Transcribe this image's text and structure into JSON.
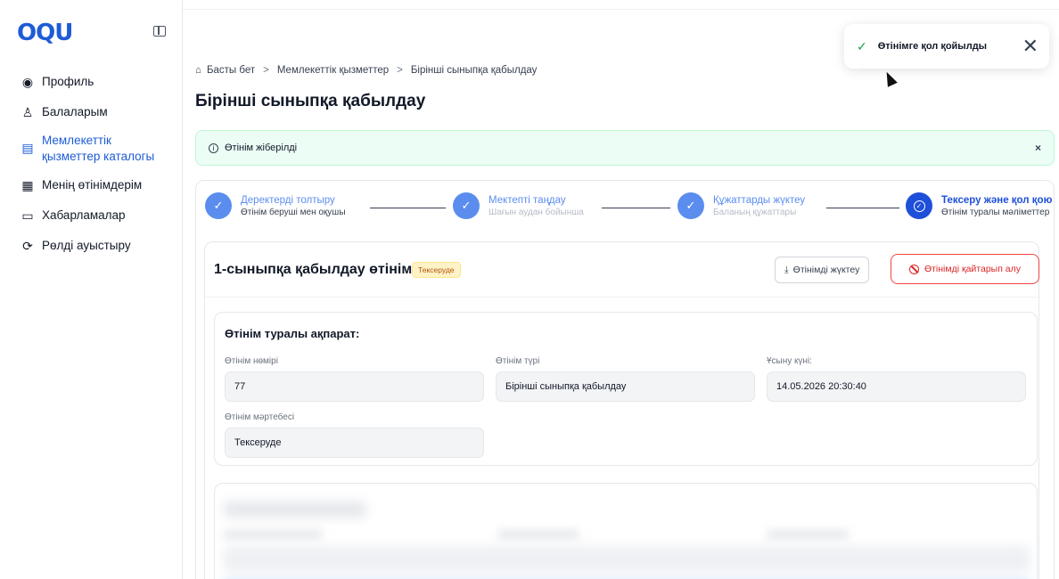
{
  "logo": {
    "text": "OQU"
  },
  "sidebar": {
    "items": [
      {
        "label": "Профиль",
        "icon": "user-circle-icon"
      },
      {
        "label": "Балаларым",
        "icon": "child-icon"
      },
      {
        "label": "Мемлекеттік қызметтер каталогы",
        "icon": "catalog-icon",
        "active": true
      },
      {
        "label": "Менің өтінімдерім",
        "icon": "clipboard-icon"
      },
      {
        "label": "Хабарламалар",
        "icon": "message-icon"
      },
      {
        "label": "Рөлді ауыстыру",
        "icon": "switch-icon"
      }
    ]
  },
  "toast": {
    "text": "Өтінімге қол қойылды",
    "close": "✕"
  },
  "breadcrumb": {
    "home": "Басты бет",
    "middle": "Мемлекеттік қызметтер",
    "current": "Бірінші сыныпқа қабылдау",
    "sep": ">"
  },
  "page": {
    "title": "Бірінші сыныпқа қабылдау"
  },
  "alert": {
    "text": "Өтінім жіберілді",
    "close": "×"
  },
  "stepper": [
    {
      "title": "Деректерді толтыру",
      "sub": "Өтінім беруші мен оқушы"
    },
    {
      "title": "Мектепті таңдау",
      "sub": "Шағын аудан бойынша"
    },
    {
      "title": "Құжаттарды жүктеу",
      "sub": "Баланың құжаттары"
    },
    {
      "title": "Тексеру және қол қою",
      "sub": "Өтінім туралы мәліметтер"
    }
  ],
  "application": {
    "title": "1-сыныпқа қабылдау өтінімі",
    "badge": "Тексеруде",
    "download_label": "Өтінімді жүктеу",
    "revoke_label": "Өтінімді қайтарып алу"
  },
  "info": {
    "title": "Өтінім туралы ақпарат:",
    "fields": [
      {
        "label": "Өтінім нөмірі",
        "value": "77"
      },
      {
        "label": "Өтінім түрі",
        "value": "Бірінші сыныпқа қабылдау"
      },
      {
        "label": "Ұсыну күні:",
        "value": "14.05.2026 20:30:40"
      },
      {
        "label": "Өтінім мәртебесі",
        "value": "Тексеруде"
      }
    ]
  },
  "colors": {
    "primary": "#1e5bd6",
    "success_bg": "#ecfdf5",
    "danger": "#dc2626",
    "badge_bg": "#fef3c7"
  }
}
